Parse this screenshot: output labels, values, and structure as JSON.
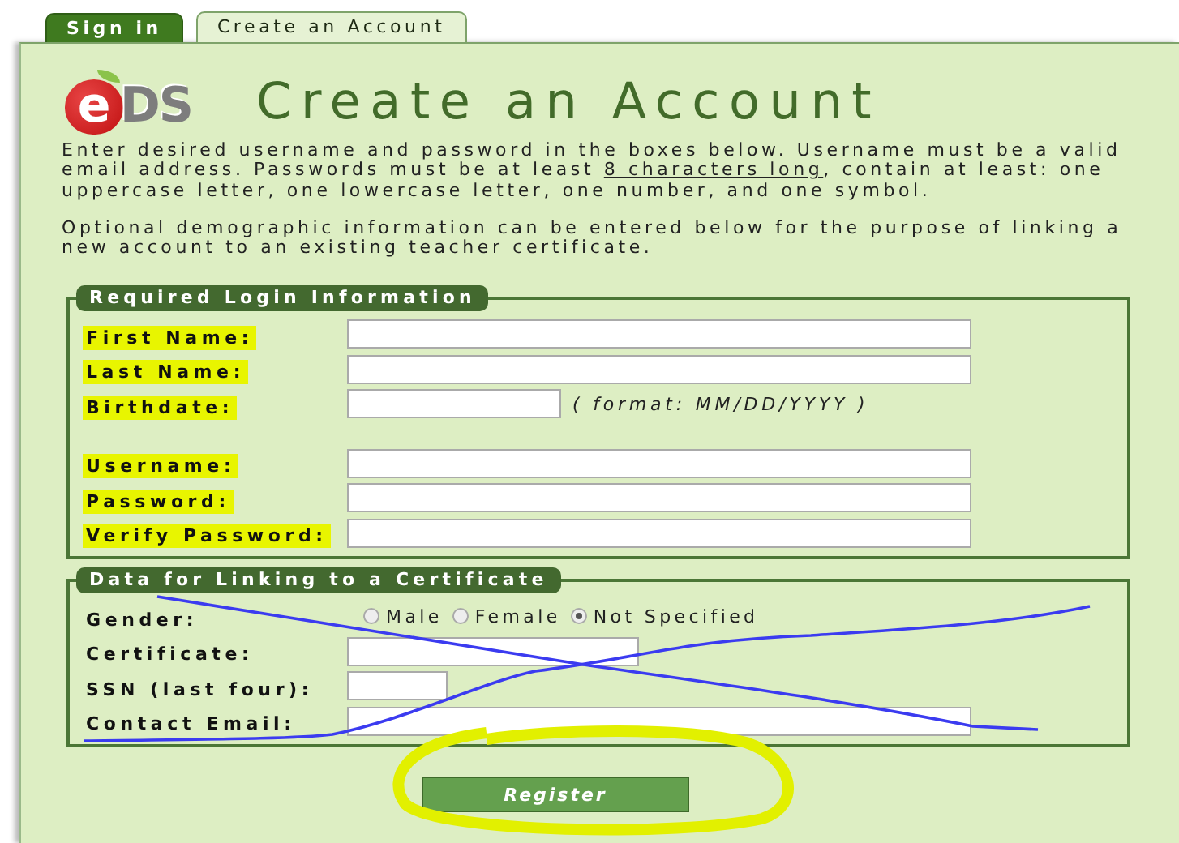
{
  "tabs": [
    {
      "label": "Sign in",
      "selected": false
    },
    {
      "label": "Create an Account",
      "selected": true
    }
  ],
  "logo": {
    "mark": "e",
    "text": "DS"
  },
  "title": "Create an Account",
  "intro": {
    "before": "Enter desired username and password in the boxes below. Username must be a valid email address. Passwords must be at least ",
    "link": "8 characters long",
    "after": ", contain at least: one uppercase letter, one lowercase letter, one number, and one symbol."
  },
  "note": "Optional demographic information can be entered below for the purpose of linking a new account to an existing teacher certificate.",
  "sections": [
    {
      "legend": "Required Login Information",
      "rows": [
        {
          "kind": "text",
          "label": "First Name:",
          "highlighted": true
        },
        {
          "kind": "text",
          "label": "Last Name:",
          "highlighted": true
        },
        {
          "kind": "date",
          "label": "Birthdate:",
          "highlighted": true,
          "hint": "( format: MM/DD/YYYY )"
        },
        {
          "kind": "gap"
        },
        {
          "kind": "text",
          "label": "Username:",
          "highlighted": true
        },
        {
          "kind": "text",
          "label": "Password:",
          "highlighted": true
        },
        {
          "kind": "text",
          "label": "Verify Password:",
          "highlighted": true
        }
      ]
    },
    {
      "legend": "Data for Linking to a Certificate",
      "rows": [
        {
          "kind": "radio",
          "label": "Gender:",
          "highlighted": false,
          "options": [
            {
              "label": "Male",
              "selected": false
            },
            {
              "label": "Female",
              "selected": false
            },
            {
              "label": "Not Specified",
              "selected": true
            }
          ]
        },
        {
          "kind": "code",
          "label": "Certificate:",
          "highlighted": false
        },
        {
          "kind": "digits",
          "label": "SSN (last four):",
          "highlighted": false
        },
        {
          "kind": "text",
          "label": "Contact Email:",
          "highlighted": false
        }
      ]
    }
  ],
  "button": "Register",
  "annotations": [
    {
      "kind": "cross",
      "color": "#3b3bf0"
    },
    {
      "kind": "circle",
      "color": "#e2f000"
    }
  ]
}
